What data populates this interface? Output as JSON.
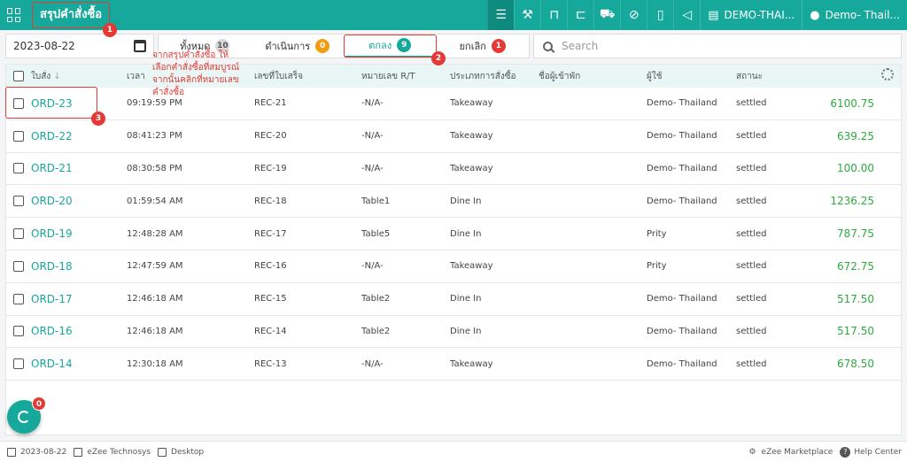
{
  "header": {
    "title": "สรุปคำสั่งซื้อ",
    "property": "DEMO-THAI...",
    "user": "Demo- Thail..."
  },
  "filters": {
    "date": "2023-08-22",
    "search_placeholder": "Search",
    "tabs": [
      {
        "label": "ทั้งหมด",
        "count": "10",
        "color": "#d8d8d8"
      },
      {
        "label": "ดำเนินการ",
        "count": "0",
        "color": "#f39c12"
      },
      {
        "label": "ตกลง",
        "count": "9",
        "color": "#16a99b"
      },
      {
        "label": "ยกเลิก",
        "count": "1",
        "color": "#e53935"
      }
    ]
  },
  "table": {
    "headers": [
      "ใบสั่ง",
      "เวลา",
      "เลขที่ใบเสร็จ",
      "หมายเลข R/T",
      "ประเภทการสั่งซื้อ",
      "ชื่อผู้เข้าพัก",
      "ผู้ใช้",
      "สถานะ"
    ],
    "rows": [
      {
        "id": "ORD-23",
        "time": "09:19:59 PM",
        "receipt": "REC-21",
        "rt": "-N/A-",
        "type": "Takeaway",
        "guest": "",
        "user": "Demo- Thailand",
        "status": "settled",
        "amount": "6100.75"
      },
      {
        "id": "ORD-22",
        "time": "08:41:23 PM",
        "receipt": "REC-20",
        "rt": "-N/A-",
        "type": "Takeaway",
        "guest": "",
        "user": "Demo- Thailand",
        "status": "settled",
        "amount": "639.25"
      },
      {
        "id": "ORD-21",
        "time": "08:30:58 PM",
        "receipt": "REC-19",
        "rt": "-N/A-",
        "type": "Takeaway",
        "guest": "",
        "user": "Demo- Thailand",
        "status": "settled",
        "amount": "100.00"
      },
      {
        "id": "ORD-20",
        "time": "01:59:54 AM",
        "receipt": "REC-18",
        "rt": "Table1",
        "type": "Dine In",
        "guest": "",
        "user": "Demo- Thailand",
        "status": "settled",
        "amount": "1236.25"
      },
      {
        "id": "ORD-19",
        "time": "12:48:28 AM",
        "receipt": "REC-17",
        "rt": "Table5",
        "type": "Dine In",
        "guest": "",
        "user": "Prity",
        "status": "settled",
        "amount": "787.75"
      },
      {
        "id": "ORD-18",
        "time": "12:47:59 AM",
        "receipt": "REC-16",
        "rt": "-N/A-",
        "type": "Takeaway",
        "guest": "",
        "user": "Prity",
        "status": "settled",
        "amount": "672.75"
      },
      {
        "id": "ORD-17",
        "time": "12:46:18 AM",
        "receipt": "REC-15",
        "rt": "Table2",
        "type": "Dine In",
        "guest": "",
        "user": "Demo- Thailand",
        "status": "settled",
        "amount": "517.50"
      },
      {
        "id": "ORD-16",
        "time": "12:46:18 AM",
        "receipt": "REC-14",
        "rt": "Table2",
        "type": "Dine In",
        "guest": "",
        "user": "Demo- Thailand",
        "status": "settled",
        "amount": "517.50"
      },
      {
        "id": "ORD-14",
        "time": "12:30:18 AM",
        "receipt": "REC-13",
        "rt": "-N/A-",
        "type": "Takeaway",
        "guest": "",
        "user": "Demo- Thailand",
        "status": "settled",
        "amount": "678.50"
      }
    ]
  },
  "annotation": {
    "note_lines": [
      "จากสรุปคำสั่งซื้อ ให้",
      "เลือกคำสั่งซื้อที่สมบูรณ์",
      "จากนั้นคลิกที่หมายเลข",
      "คำสั่งซื้อ"
    ],
    "markers": [
      "1",
      "2",
      "3"
    ],
    "color": "#e53935"
  },
  "fab": {
    "badge": "0"
  },
  "footer": {
    "date": "2023-08-22",
    "company": "eZee Technosys",
    "mode": "Desktop",
    "marketplace": "eZee Marketplace",
    "help": "Help Center"
  },
  "colors": {
    "accent": "#16a99b",
    "amount": "#2eaa3f"
  }
}
